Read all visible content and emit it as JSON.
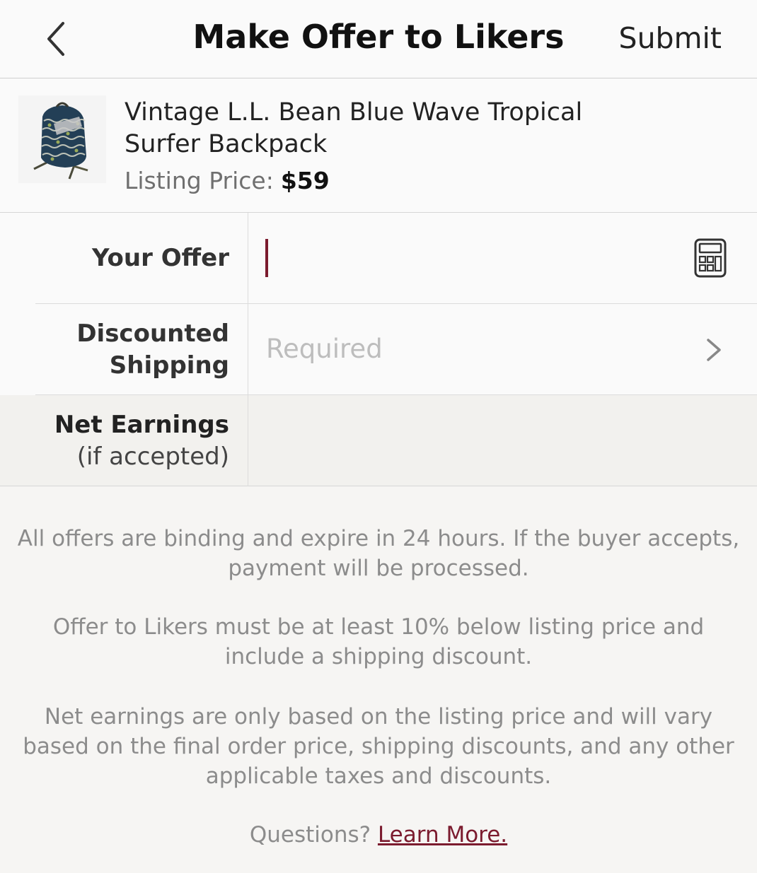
{
  "header": {
    "title": "Make Offer to Likers",
    "submit_label": "Submit",
    "back_icon": "chevron-left-icon"
  },
  "listing": {
    "title": "Vintage L.L. Bean Blue Wave Tropical Surfer Backpack",
    "price_label": "Listing Price:",
    "price_value": "$59",
    "thumbnail": "backpack-image"
  },
  "form": {
    "offer": {
      "label": "Your Offer",
      "value": "",
      "calculator_icon": "calculator-icon"
    },
    "shipping": {
      "label_line1": "Discounted",
      "label_line2": "Shipping",
      "value": "Required",
      "chevron_icon": "chevron-right-icon"
    },
    "net": {
      "label_line1": "Net Earnings",
      "label_line2": "(if accepted)",
      "value": ""
    }
  },
  "info": {
    "paragraph1": "All offers are binding and expire in 24 hours. If the buyer accepts, payment will be processed.",
    "paragraph2": "Offer to Likers must be at least 10% below listing price and include a shipping discount.",
    "paragraph3": "Net earnings are only based on the listing price and will vary based on the final order price, shipping discounts, and any other applicable taxes and discounts.",
    "questions_label": "Questions?",
    "learn_more_label": "Learn More."
  },
  "colors": {
    "accent": "#7b1b2e",
    "background": "#f6f5f3",
    "placeholder": "#bdbdbd"
  }
}
